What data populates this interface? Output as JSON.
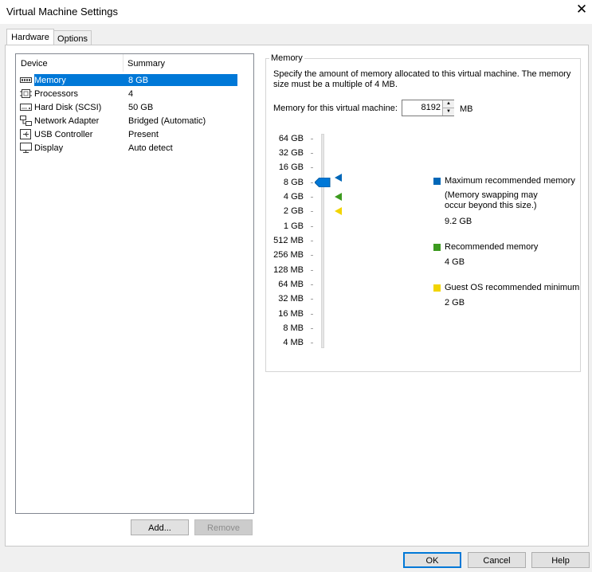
{
  "window": {
    "title": "Virtual Machine Settings"
  },
  "tabs": [
    {
      "label": "Hardware"
    },
    {
      "label": "Options"
    }
  ],
  "device_list": {
    "headers": {
      "device": "Device",
      "summary": "Summary"
    },
    "rows": [
      {
        "device": "Memory",
        "summary": "8 GB",
        "icon": "memory-icon",
        "selected": true
      },
      {
        "device": "Processors",
        "summary": "4",
        "icon": "processor-icon"
      },
      {
        "device": "Hard Disk (SCSI)",
        "summary": "50 GB",
        "icon": "hard-disk-icon"
      },
      {
        "device": "Network Adapter",
        "summary": "Bridged (Automatic)",
        "icon": "network-adapter-icon"
      },
      {
        "device": "USB Controller",
        "summary": "Present",
        "icon": "usb-controller-icon"
      },
      {
        "device": "Display",
        "summary": "Auto detect",
        "icon": "display-icon"
      }
    ]
  },
  "list_buttons": {
    "add": "Add...",
    "remove": "Remove"
  },
  "memory": {
    "group_title": "Memory",
    "description": "Specify the amount of memory allocated to this virtual machine. The memory size must be a multiple of 4 MB.",
    "field_label": "Memory for this virtual machine:",
    "field_value": "8192",
    "unit": "MB",
    "scale": [
      "64 GB",
      "32 GB",
      "16 GB",
      "8 GB",
      "4 GB",
      "2 GB",
      "1 GB",
      "512 MB",
      "256 MB",
      "128 MB",
      "64 MB",
      "32 MB",
      "16 MB",
      "8 MB",
      "4 MB"
    ],
    "slider_value": "8 GB",
    "legend": [
      {
        "label": "Maximum recommended memory",
        "note": "(Memory swapping may occur beyond this size.)",
        "value": "9.2 GB",
        "color": "#0067b8"
      },
      {
        "label": "Recommended memory",
        "value": "4 GB",
        "color": "#3c9a1f"
      },
      {
        "label": "Guest OS recommended minimum",
        "value": "2 GB",
        "color": "#f2d400"
      }
    ]
  },
  "footer": {
    "ok": "OK",
    "cancel": "Cancel",
    "help": "Help"
  }
}
